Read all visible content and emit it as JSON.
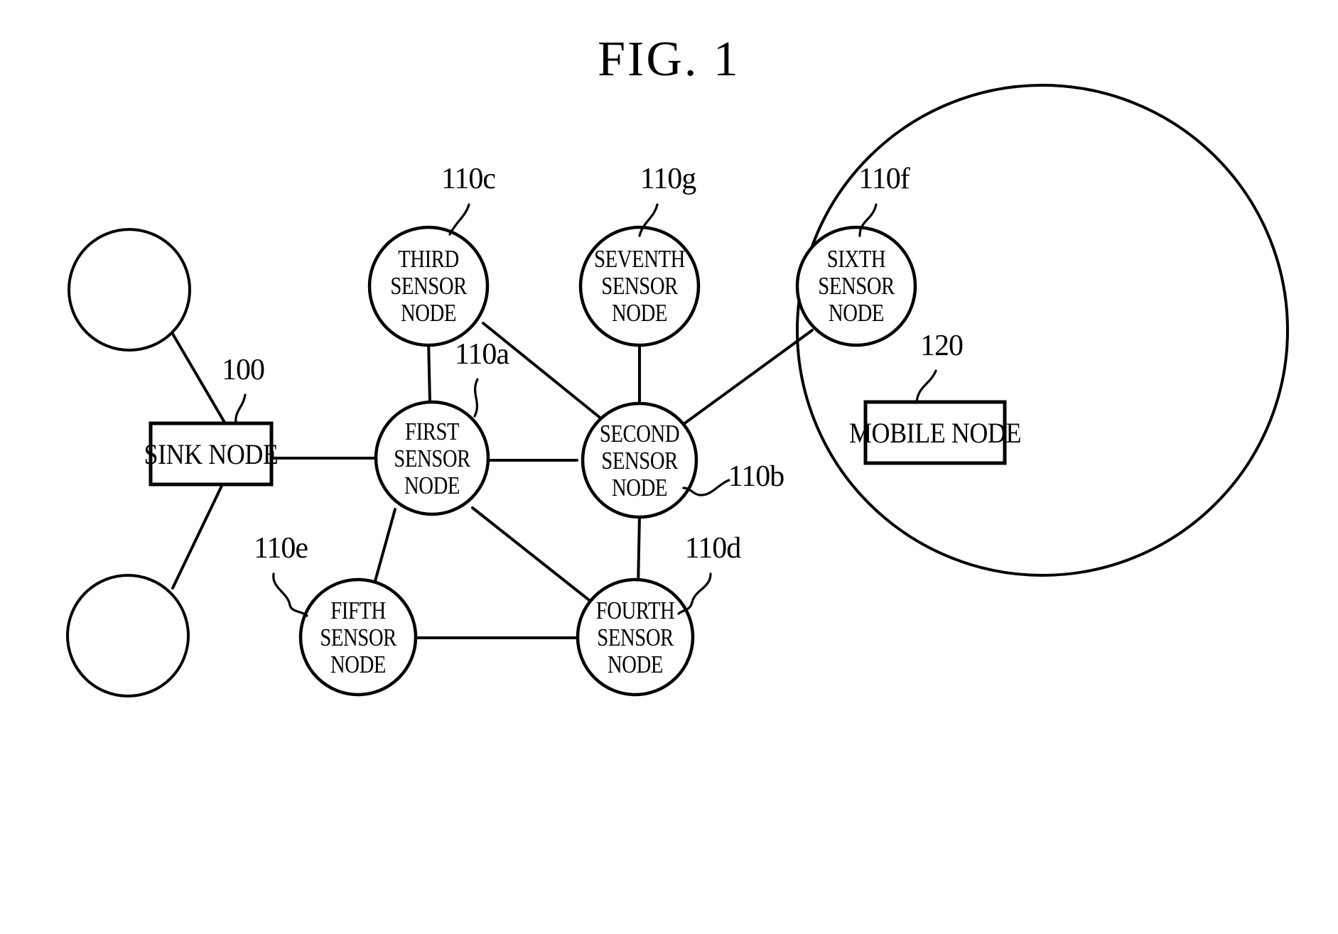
{
  "figure": {
    "title": "FIG. 1",
    "type": "patent-diagram",
    "description": "Wireless sensor network topology diagram"
  },
  "nodes": {
    "sink": {
      "label": "SINK NODE",
      "ref": "100",
      "shape": "rectangle"
    },
    "mobile": {
      "label": "MOBILE NODE",
      "ref": "120",
      "shape": "rectangle"
    },
    "first": {
      "line1": "FIRST",
      "line2": "SENSOR",
      "line3": "NODE",
      "ref": "110a",
      "shape": "circle"
    },
    "second": {
      "line1": "SECOND",
      "line2": "SENSOR",
      "line3": "NODE",
      "ref": "110b",
      "shape": "circle"
    },
    "third": {
      "line1": "THIRD",
      "line2": "SENSOR",
      "line3": "NODE",
      "ref": "110c",
      "shape": "circle"
    },
    "fourth": {
      "line1": "FOURTH",
      "line2": "SENSOR",
      "line3": "NODE",
      "ref": "110d",
      "shape": "circle"
    },
    "fifth": {
      "line1": "FIFTH",
      "line2": "SENSOR",
      "line3": "NODE",
      "ref": "110e",
      "shape": "circle"
    },
    "sixth": {
      "line1": "SIXTH",
      "line2": "SENSOR",
      "line3": "NODE",
      "ref": "110f",
      "shape": "circle"
    },
    "seventh": {
      "line1": "SEVENTH",
      "line2": "SENSOR",
      "line3": "NODE",
      "ref": "110g",
      "shape": "circle"
    },
    "unlabeled_top": {
      "label": "",
      "shape": "circle"
    },
    "unlabeled_bottom": {
      "label": "",
      "shape": "circle"
    }
  },
  "colors": {
    "stroke": "#000000",
    "background": "#ffffff"
  }
}
